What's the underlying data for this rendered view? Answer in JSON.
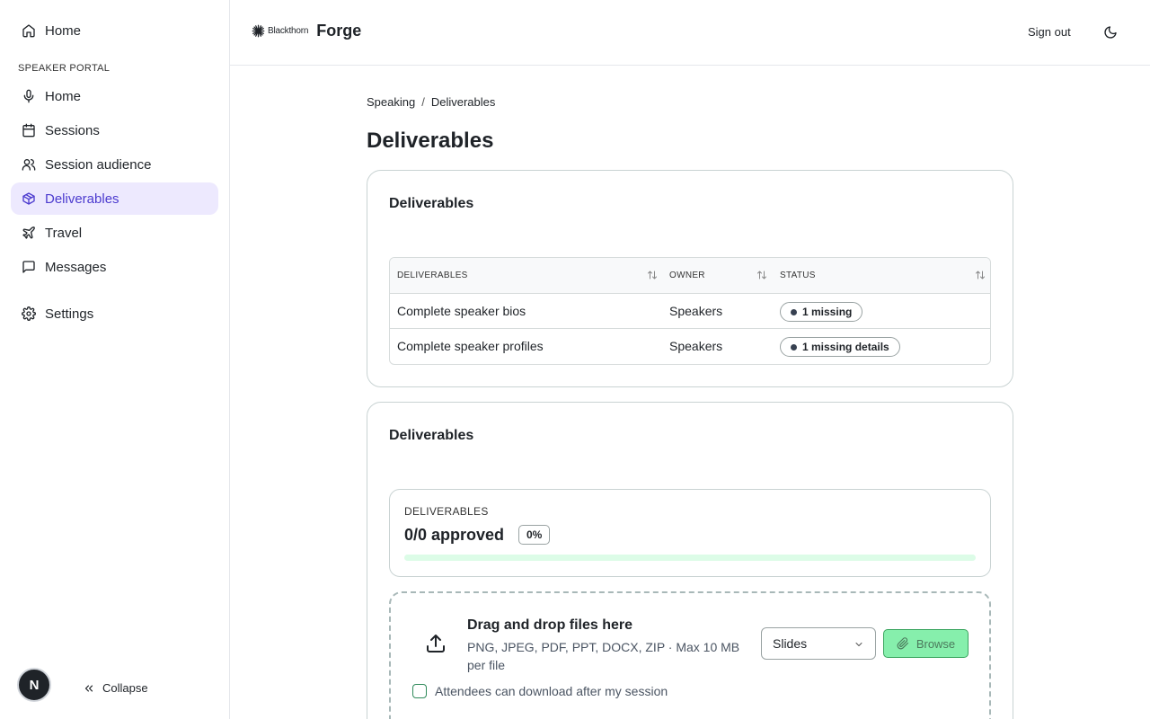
{
  "sidebar": {
    "top_item": {
      "label": "Home",
      "icon": "home-icon"
    },
    "section_label": "SPEAKER PORTAL",
    "items": [
      {
        "label": "Home",
        "icon": "microphone-icon"
      },
      {
        "label": "Sessions",
        "icon": "calendar-icon"
      },
      {
        "label": "Session audience",
        "icon": "users-icon"
      },
      {
        "label": "Deliverables",
        "icon": "package-icon",
        "active": true
      },
      {
        "label": "Travel",
        "icon": "plane-icon"
      },
      {
        "label": "Messages",
        "icon": "message-icon"
      }
    ],
    "settings": {
      "label": "Settings",
      "icon": "gear-icon"
    },
    "avatar_initial": "N",
    "collapse_label": "Collapse"
  },
  "header": {
    "company": "Blackthorn",
    "product": "Forge",
    "signout_label": "Sign out"
  },
  "breadcrumb": {
    "parent": "Speaking",
    "separator": "/",
    "current": "Deliverables"
  },
  "page_title": "Deliverables",
  "deliverables_card": {
    "title": "Deliverables",
    "columns": [
      "DELIVERABLES",
      "OWNER",
      "STATUS"
    ],
    "rows": [
      {
        "name": "Complete speaker bios",
        "owner": "Speakers",
        "status": "1 missing"
      },
      {
        "name": "Complete speaker profiles",
        "owner": "Speakers",
        "status": "1 missing details"
      }
    ]
  },
  "upload_card": {
    "title": "Deliverables",
    "progress": {
      "label": "DELIVERABLES",
      "value": "0/0 approved",
      "percent_label": "0%",
      "percent": 0
    },
    "dropzone": {
      "title": "Drag and drop files here",
      "subtitle": "PNG, JPEG, PDF, PPT, DOCX, ZIP · Max 10 MB per file",
      "type_selected": "Slides",
      "browse_label": "Browse",
      "checkbox_label": "Attendees can download after my session",
      "checkbox_checked": false
    }
  },
  "colors": {
    "accent": "#4c3bcf",
    "active_bg": "#ede9fe",
    "success": "#86efac",
    "progress_track": "#dcfce7"
  }
}
